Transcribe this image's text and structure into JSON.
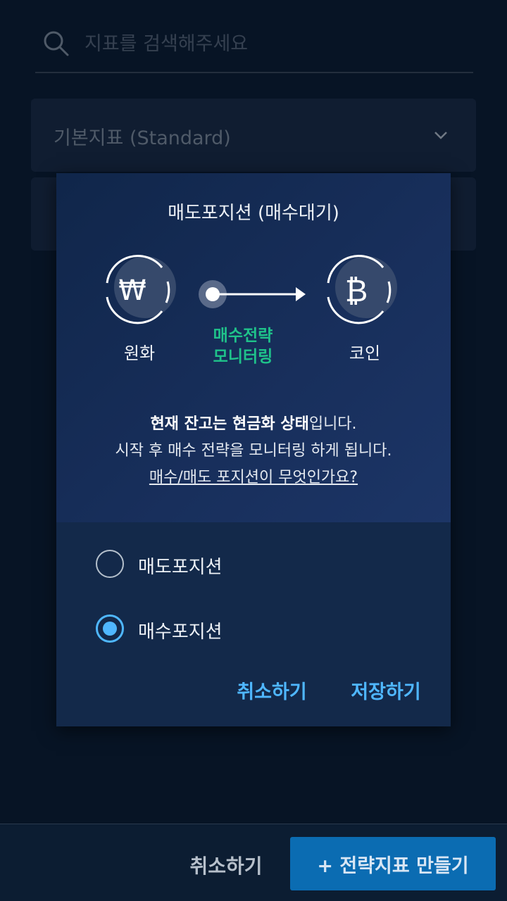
{
  "search": {
    "placeholder": "지표를 검색해주세요",
    "icon": "search-icon"
  },
  "panels": [
    {
      "label": "기본지표 (Standard)",
      "icon": "chevron-down-icon"
    },
    {
      "label": ""
    }
  ],
  "modal": {
    "title": "매도포지션 (매수대기)",
    "from_label": "원화",
    "to_label": "코인",
    "monitor_line1": "매수전략",
    "monitor_line2": "모니터링",
    "desc_bold": "현재 잔고는 현금화 상태",
    "desc_rest1": "입니다.",
    "desc_line2": "시작 후 매수 전략을 모니터링 하게 됩니다.",
    "help_link": "매수/매도 포지션이 무엇인가요?",
    "options": [
      {
        "label": "매도포지션",
        "checked": false
      },
      {
        "label": "매수포지션",
        "checked": true
      }
    ],
    "cancel_label": "취소하기",
    "save_label": "저장하기"
  },
  "bottom_bar": {
    "cancel_label": "취소하기",
    "create_label": "+ 전략지표 만들기"
  },
  "colors": {
    "background": "#0a1b2e",
    "modal": "#13294a",
    "accent": "#4fb7ff",
    "green": "#1fc28a",
    "primary_button": "#0b6cb2"
  }
}
